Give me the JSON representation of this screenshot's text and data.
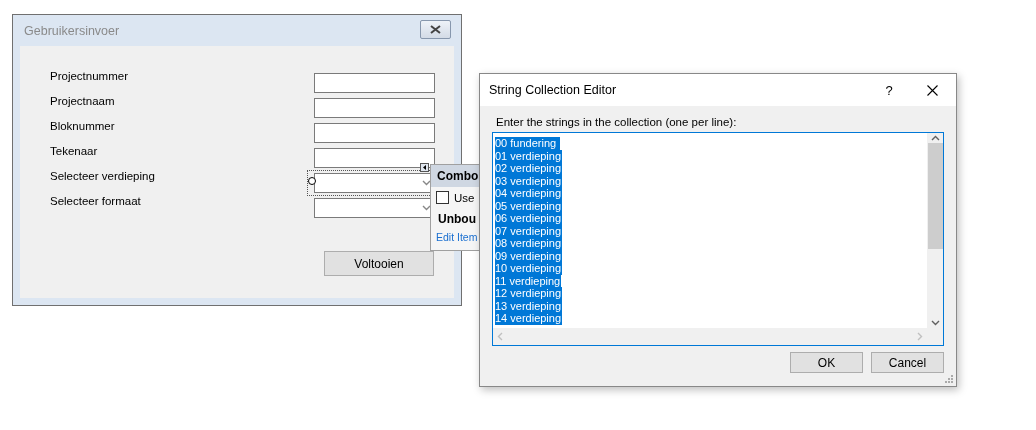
{
  "form_window": {
    "title": "Gebruikersinvoer",
    "fields": [
      {
        "label": "Projectnummer",
        "kind": "text",
        "selected": false
      },
      {
        "label": "Projectnaam",
        "kind": "text",
        "selected": false
      },
      {
        "label": "Bloknummer",
        "kind": "text",
        "selected": false
      },
      {
        "label": "Tekenaar",
        "kind": "text",
        "selected": false
      },
      {
        "label": "Selecteer verdieping",
        "kind": "combo",
        "selected": true
      },
      {
        "label": "Selecteer formaat",
        "kind": "combo",
        "selected": false
      }
    ],
    "button": "Voltooien"
  },
  "smart_tag": {
    "header": "Combo",
    "checkbox": {
      "label": "Use",
      "checked": false
    },
    "section": "Unbou",
    "link": "Edit Item"
  },
  "editor": {
    "title": "String Collection Editor",
    "help": "?",
    "instruction": "Enter the strings in the collection (one per line):",
    "text_selected": true,
    "lines": [
      "00 fundering",
      "01 verdieping",
      "02 verdieping",
      "03 verdieping",
      "04 verdieping",
      "05 verdieping",
      "06 verdieping",
      "07 verdieping",
      "08 verdieping",
      "09 verdieping",
      "10 verdieping",
      "11 verdieping",
      "12 verdieping",
      "13 verdieping",
      "14 verdieping"
    ],
    "buttons": [
      "OK",
      "Cancel"
    ]
  }
}
